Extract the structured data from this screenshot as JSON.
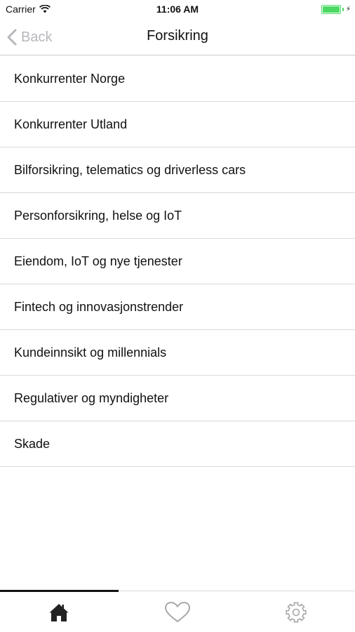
{
  "status_bar": {
    "carrier": "Carrier",
    "time": "11:06 AM",
    "wifi_icon": "wifi-icon",
    "battery_level": 1.0,
    "battery_color": "#4cd964"
  },
  "nav": {
    "back_label": "Back",
    "title": "Forsikring",
    "back_icon": "chevron-left-icon"
  },
  "list": {
    "items": [
      {
        "label": "Konkurrenter Norge"
      },
      {
        "label": "Konkurrenter Utland"
      },
      {
        "label": "Bilforsikring, telematics og driverless cars"
      },
      {
        "label": "Personforsikring, helse og IoT"
      },
      {
        "label": "Eiendom, IoT og nye tjenester"
      },
      {
        "label": "Fintech og innovasjonstrender"
      },
      {
        "label": "Kundeinnsikt og millennials"
      },
      {
        "label": "Regulativer og myndigheter"
      },
      {
        "label": "Skade"
      }
    ]
  },
  "tab_bar": {
    "tabs": [
      {
        "icon": "home-icon",
        "selected": true
      },
      {
        "icon": "heart-icon",
        "selected": false
      },
      {
        "icon": "gear-icon",
        "selected": false
      }
    ]
  },
  "colors": {
    "accent_inactive": "#b7b7bc",
    "separator": "#d9d9dc",
    "tab_icon_inactive": "#a8a8a8",
    "tab_icon_active": "#222222"
  }
}
